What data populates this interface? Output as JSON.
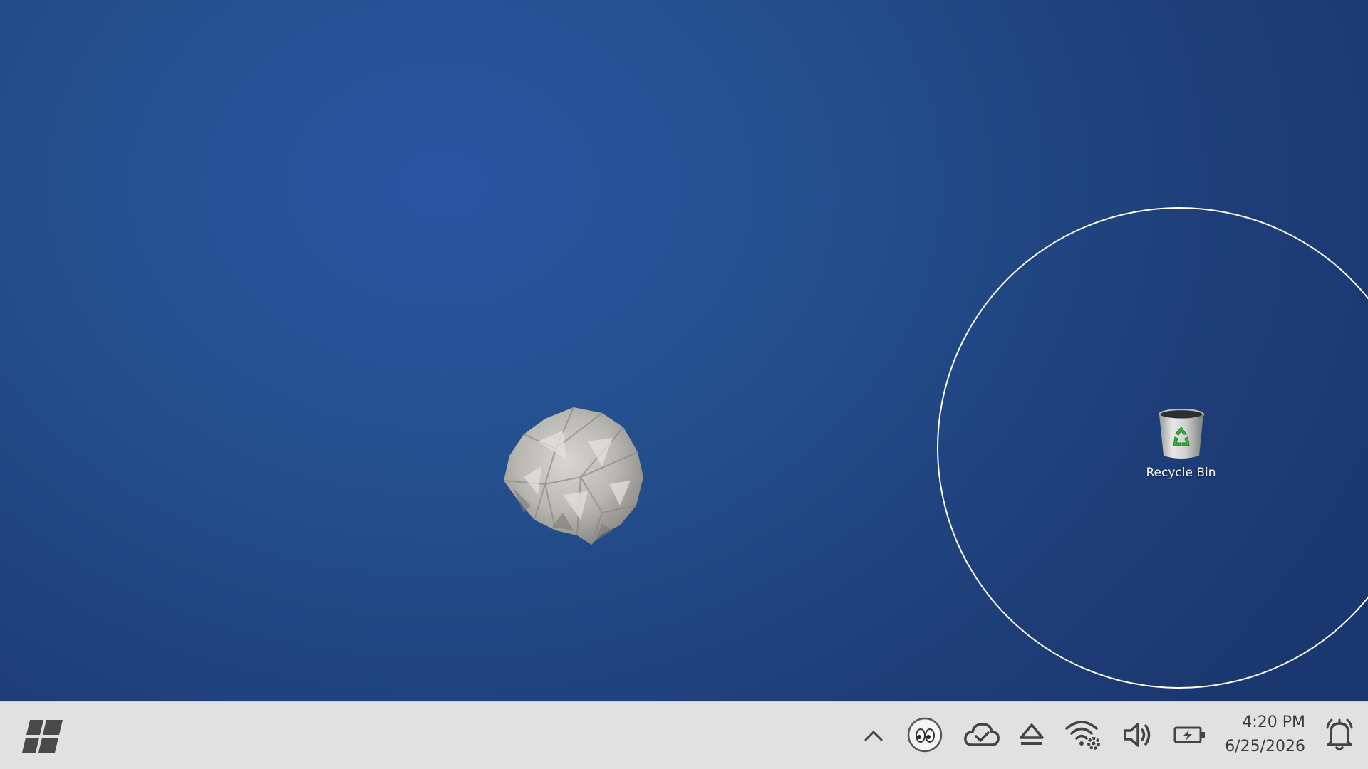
{
  "desktop": {
    "icons": [
      {
        "label": "Recycle Bin",
        "icon": "recycle-bin-icon"
      }
    ],
    "floating_object": "crumpled-paper-ball-icon",
    "colors": {
      "wallpaper": "#24508f",
      "wallpaper_dark": "#1b3770",
      "focus_ring": "#ffffff"
    }
  },
  "taskbar": {
    "start_icon": "windows-logo-icon",
    "tray": {
      "overflow_icon": "chevron-up-icon",
      "app_icon": "eyes-app-icon",
      "cloud_icon": "cloud-sync-check-icon",
      "eject_icon": "eject-icon",
      "wifi_icon": "wifi-settings-icon",
      "volume_icon": "speaker-volume-icon",
      "battery_icon": "battery-charging-icon",
      "notification_icon": "notification-bell-icon"
    },
    "clock": {
      "time": "4:20 PM",
      "date": "6/25/2026"
    },
    "colors": {
      "background": "#e1e1e1",
      "icon": "#555555"
    }
  }
}
